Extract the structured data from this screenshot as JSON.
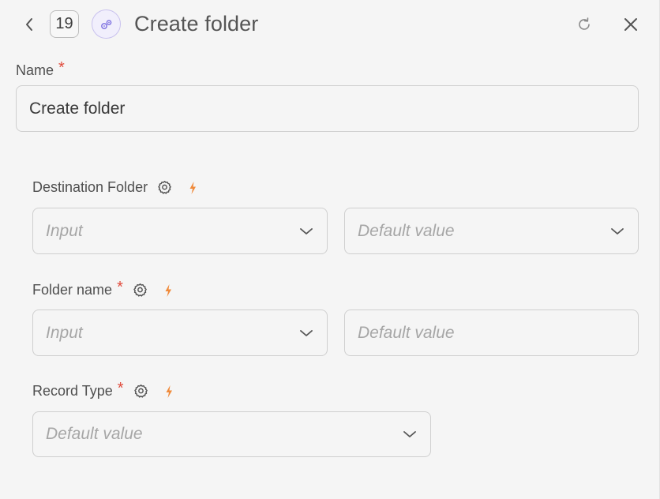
{
  "header": {
    "step_number": "19",
    "title": "Create folder"
  },
  "name_field": {
    "label": "Name",
    "required_mark": "*",
    "value": "Create folder"
  },
  "fields": [
    {
      "label": "Destination Folder",
      "required_mark": "",
      "input_placeholder": "Input",
      "default_placeholder": "Default value"
    },
    {
      "label": "Folder name",
      "required_mark": "*",
      "input_placeholder": "Input",
      "default_placeholder": "Default value"
    },
    {
      "label": "Record Type",
      "required_mark": "*",
      "default_placeholder": "Default value"
    }
  ],
  "icons": {
    "back": "chevron-left-icon",
    "node": "workflow-node-icon",
    "refresh": "refresh-icon",
    "close": "close-icon",
    "settings": "gear-icon",
    "dynamic": "lightning-bolt-icon",
    "dropdown": "chevron-down-icon"
  },
  "colors": {
    "required": "#e0493a",
    "bolt": "#f08a3a",
    "node_accent": "#7b6ee0",
    "background": "#f5f5f5"
  }
}
